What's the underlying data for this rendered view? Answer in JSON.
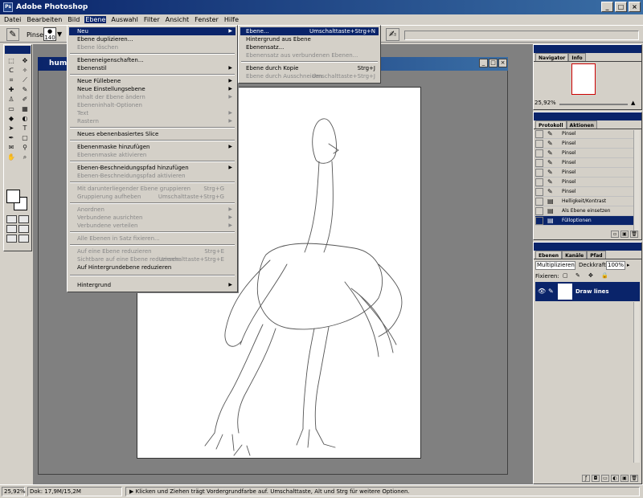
{
  "app": {
    "title": "Adobe Photoshop",
    "icon_label": "Ps"
  },
  "window_buttons": {
    "minimize": "_",
    "maximize": "□",
    "close": "×"
  },
  "menubar": [
    "Datei",
    "Bearbeiten",
    "Bild",
    "Ebene",
    "Auswahl",
    "Filter",
    "Ansicht",
    "Fenster",
    "Hilfe"
  ],
  "options_bar": {
    "label": "Pinsel:",
    "brush_size": "140"
  },
  "document": {
    "title": "huma"
  },
  "ebene_menu": [
    {
      "label": "Neu",
      "sub": true,
      "state": "highlight"
    },
    {
      "label": "Ebene duplizieren...",
      "state": "normal"
    },
    {
      "label": "Ebene löschen",
      "state": "disabled"
    },
    {
      "label": "Ebeneneigenschaften...",
      "state": "normal"
    },
    {
      "label": "Ebenenstil",
      "sub": true,
      "state": "normal"
    },
    {
      "label": "Neue Füllebene",
      "sub": true,
      "state": "normal"
    },
    {
      "label": "Neue Einstellungsebene",
      "sub": true,
      "state": "normal"
    },
    {
      "label": "Inhalt der Ebene ändern",
      "sub": true,
      "state": "disabled"
    },
    {
      "label": "Ebeneninhalt-Optionen",
      "state": "disabled"
    },
    {
      "label": "Text",
      "sub": true,
      "state": "disabled"
    },
    {
      "label": "Rastern",
      "sub": true,
      "state": "disabled"
    },
    {
      "label": "Neues ebenenbasiertes Slice",
      "state": "normal"
    },
    {
      "label": "Ebenenmaske hinzufügen",
      "sub": true,
      "state": "normal"
    },
    {
      "label": "Ebenenmaske aktivieren",
      "state": "disabled"
    },
    {
      "label": "Ebenen-Beschneidungspfad hinzufügen",
      "sub": true,
      "state": "normal"
    },
    {
      "label": "Ebenen-Beschneidungspfad aktivieren",
      "state": "disabled"
    },
    {
      "label": "Mit darunterliegender Ebene gruppieren",
      "shortcut": "Strg+G",
      "state": "disabled"
    },
    {
      "label": "Gruppierung aufheben",
      "shortcut": "Umschalttaste+Strg+G",
      "state": "disabled"
    },
    {
      "label": "Anordnen",
      "sub": true,
      "state": "disabled"
    },
    {
      "label": "Verbundene ausrichten",
      "sub": true,
      "state": "disabled"
    },
    {
      "label": "Verbundene verteilen",
      "sub": true,
      "state": "disabled"
    },
    {
      "label": "Alle Ebenen in Satz fixieren...",
      "state": "disabled"
    },
    {
      "label": "Auf eine Ebene reduzieren",
      "shortcut": "Strg+E",
      "state": "disabled"
    },
    {
      "label": "Sichtbare auf eine Ebene reduzieren",
      "shortcut": "Umschalttaste+Strg+E",
      "state": "disabled"
    },
    {
      "label": "Auf Hintergrundebene reduzieren",
      "state": "normal"
    },
    {
      "label": "Hintergrund",
      "sub": true,
      "state": "normal"
    }
  ],
  "neu_submenu": [
    {
      "label": "Ebene...",
      "shortcut": "Umschalttaste+Strg+N",
      "state": "highlight"
    },
    {
      "label": "Hintergrund aus Ebene",
      "state": "normal"
    },
    {
      "label": "Ebenensatz...",
      "state": "normal"
    },
    {
      "label": "Ebenensatz aus verbundenen Ebenen...",
      "state": "disabled"
    },
    {
      "label": "Ebene durch Kopie",
      "shortcut": "Strg+J",
      "state": "normal"
    },
    {
      "label": "Ebene durch Ausschneiden",
      "shortcut": "Umschalttaste+Strg+J",
      "state": "disabled"
    }
  ],
  "navigator": {
    "tabs": [
      "Navigator",
      "Info"
    ],
    "zoom": "25,92%"
  },
  "history": {
    "tabs": [
      "Protokoll",
      "Aktionen"
    ],
    "items": [
      {
        "label": "Pinsel",
        "icon": "brush-icon"
      },
      {
        "label": "Pinsel",
        "icon": "brush-icon"
      },
      {
        "label": "Pinsel",
        "icon": "brush-icon"
      },
      {
        "label": "Pinsel",
        "icon": "brush-icon"
      },
      {
        "label": "Pinsel",
        "icon": "brush-icon"
      },
      {
        "label": "Pinsel",
        "icon": "brush-icon"
      },
      {
        "label": "Pinsel",
        "icon": "brush-icon"
      },
      {
        "label": "Helligkeit/Kontrast",
        "icon": "adjust-icon"
      },
      {
        "label": "Als Ebene einsetzen",
        "icon": "paste-icon"
      },
      {
        "label": "Fülloptionen",
        "icon": "layer-icon"
      }
    ]
  },
  "layers": {
    "tabs": [
      "Ebenen",
      "Kanäle",
      "Pfad"
    ],
    "blend_mode": "Multiplizieren",
    "opacity_label": "Deckkraft:",
    "opacity": "100%",
    "lock_label": "Fixieren:",
    "layer_name": "Draw lines"
  },
  "status": {
    "zoom": "25,92%",
    "doc": "Dok: 17,9M/15,2M",
    "hint": "Klicken und Ziehen trägt Vordergrundfarbe auf. Umschalttaste, Alt und Strg für weitere Optionen."
  },
  "colors": {
    "title_dark": "#0a246a",
    "title_light": "#3a6ea5",
    "face": "#d4d0c8",
    "workspace": "#808080"
  }
}
